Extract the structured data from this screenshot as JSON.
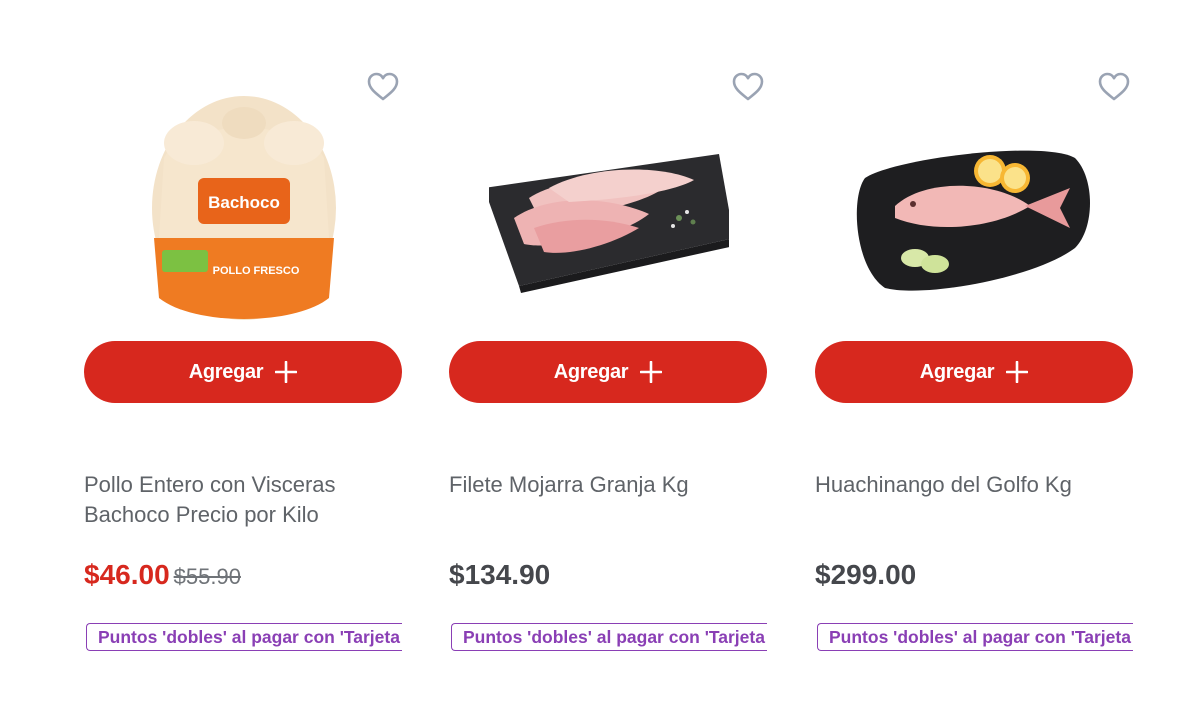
{
  "products": [
    {
      "name": "Pollo Entero con Visceras Bachoco Precio por Kilo",
      "price": "$46.00",
      "old_price": "$55.90",
      "add_label": "Agregar",
      "promo": "Puntos 'dobles' al pagar con 'Tarjeta",
      "brand_on_package": "Bachoco",
      "package_text": "POLLO FRESCO"
    },
    {
      "name": "Filete Mojarra Granja Kg",
      "price": "$134.90",
      "add_label": "Agregar",
      "promo": "Puntos 'dobles' al pagar con 'Tarjeta"
    },
    {
      "name": "Huachinango del Golfo Kg",
      "price": "$299.00",
      "add_label": "Agregar",
      "promo": "Puntos 'dobles' al pagar con 'Tarjeta"
    }
  ],
  "icons": {
    "favorite": "heart-outline-icon",
    "add": "plus-icon"
  },
  "colors": {
    "primary_button": "#d7281e",
    "sale_price": "#d7281e",
    "regular_price": "#45474c",
    "promo": "#8a3fb5",
    "heart": "#9aa3b3",
    "title": "#5f6368"
  }
}
